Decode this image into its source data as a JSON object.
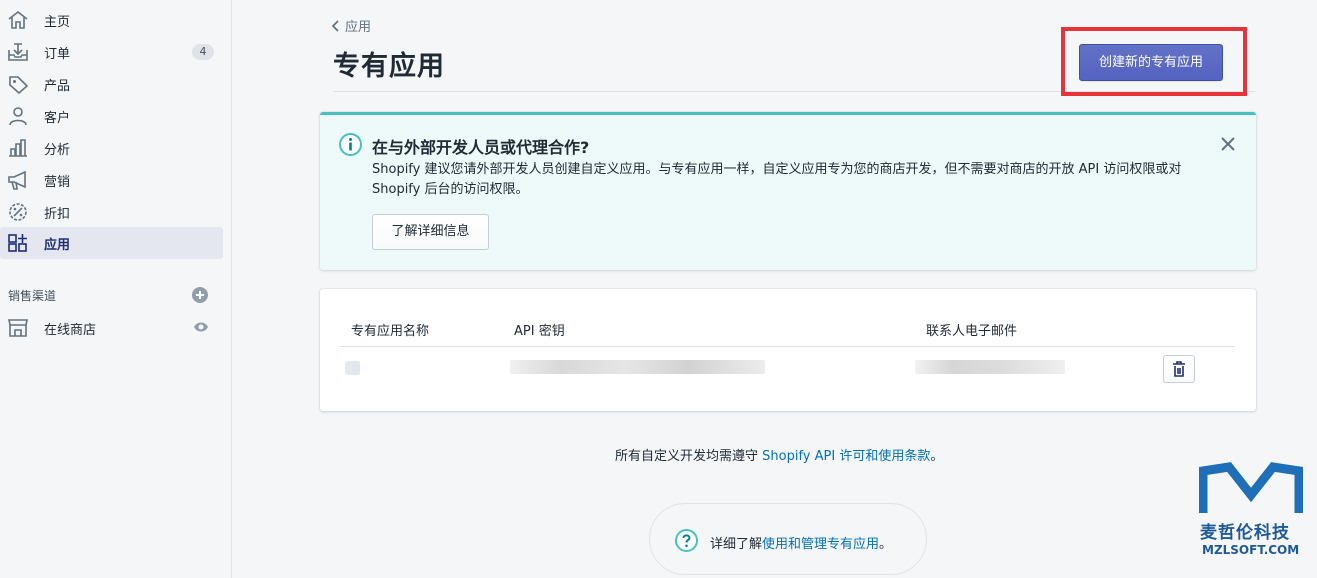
{
  "sidebar": {
    "items": [
      {
        "label": "主页",
        "icon": "home-icon"
      },
      {
        "label": "订单",
        "icon": "orders-icon",
        "badge": "4"
      },
      {
        "label": "产品",
        "icon": "tag-icon"
      },
      {
        "label": "客户",
        "icon": "person-icon"
      },
      {
        "label": "分析",
        "icon": "analytics-icon"
      },
      {
        "label": "营销",
        "icon": "megaphone-icon"
      },
      {
        "label": "折扣",
        "icon": "discount-icon"
      },
      {
        "label": "应用",
        "icon": "apps-icon",
        "active": true
      }
    ],
    "sales_channels_title": "销售渠道",
    "online_store_label": "在线商店"
  },
  "header": {
    "breadcrumb": "应用",
    "title": "专有应用",
    "create_button": "创建新的专有应用"
  },
  "banner": {
    "title": "在与外部开发人员或代理合作?",
    "text": "Shopify 建议您请外部开发人员创建自定义应用。与专有应用一样，自定义应用专为您的商店开发，但不需要对商店的开放 API 访问权限或对 Shopify 后台的访问权限。",
    "button": "了解详细信息"
  },
  "table": {
    "headers": [
      "专有应用名称",
      "API 密钥",
      "联系人电子邮件"
    ]
  },
  "footer": {
    "prefix": "所有自定义开发均需遵守 ",
    "link": "Shopify API 许可和使用条款",
    "suffix": "。"
  },
  "help": {
    "prefix": "详细了解",
    "link": "使用和管理专有应用",
    "suffix": "。"
  },
  "watermark": {
    "cn": "麦哲伦科技",
    "en": "MZLSOFT.COM"
  },
  "colors": {
    "primary": "#5c6ac4",
    "highlight": "#e8333a",
    "banner_accent": "#47c1bf",
    "link": "#006fbb"
  }
}
